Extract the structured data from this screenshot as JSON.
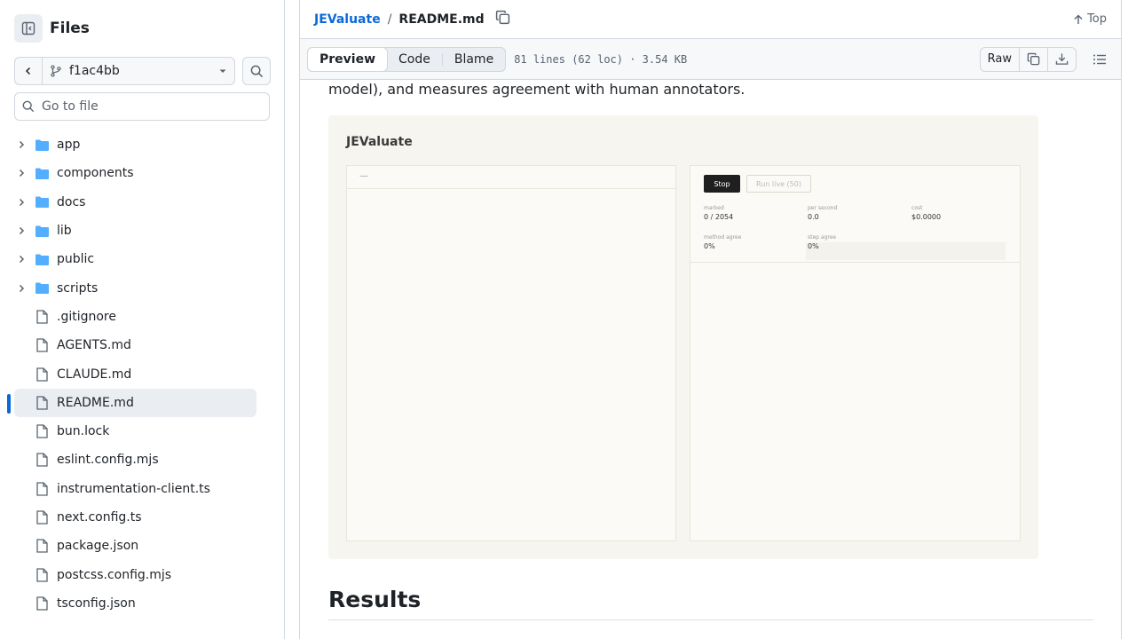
{
  "sidebar": {
    "title": "Files",
    "branch": "f1ac4bb",
    "goto_placeholder": "Go to file",
    "items": [
      {
        "label": "app",
        "type": "folder"
      },
      {
        "label": "components",
        "type": "folder"
      },
      {
        "label": "docs",
        "type": "folder"
      },
      {
        "label": "lib",
        "type": "folder"
      },
      {
        "label": "public",
        "type": "folder"
      },
      {
        "label": "scripts",
        "type": "folder"
      },
      {
        "label": ".gitignore",
        "type": "file"
      },
      {
        "label": "AGENTS.md",
        "type": "file"
      },
      {
        "label": "CLAUDE.md",
        "type": "file"
      },
      {
        "label": "README.md",
        "type": "file",
        "selected": true
      },
      {
        "label": "bun.lock",
        "type": "file"
      },
      {
        "label": "eslint.config.mjs",
        "type": "file"
      },
      {
        "label": "instrumentation-client.ts",
        "type": "file"
      },
      {
        "label": "next.config.ts",
        "type": "file"
      },
      {
        "label": "package.json",
        "type": "file"
      },
      {
        "label": "postcss.config.mjs",
        "type": "file"
      },
      {
        "label": "tsconfig.json",
        "type": "file"
      }
    ]
  },
  "header": {
    "repo": "JEValuate",
    "separator": "/",
    "file": "README.md",
    "top_label": "Top"
  },
  "toolbar": {
    "tabs": [
      "Preview",
      "Code",
      "Blame"
    ],
    "active_tab": "Preview",
    "meta": "81 lines (62 loc) · 3.54 KB",
    "raw_label": "Raw"
  },
  "content": {
    "paragraph": "model), and measures agreement with human annotators.",
    "results_heading": "Results",
    "screenshot": {
      "title": "JEValuate",
      "left_header": "—",
      "stop_label": "Stop",
      "run_label": "Run live (50)",
      "stats": [
        {
          "key": "marked",
          "value": "0 / 2054"
        },
        {
          "key": "per second",
          "value": "0.0"
        },
        {
          "key": "cost",
          "value": "$0.0000"
        },
        {
          "key": "method agree",
          "value": "0%"
        },
        {
          "key": "step agree",
          "value": "0%"
        }
      ]
    }
  },
  "colors": {
    "accent": "#0969da",
    "folder": "#54aeff",
    "border": "#d0d7de"
  }
}
